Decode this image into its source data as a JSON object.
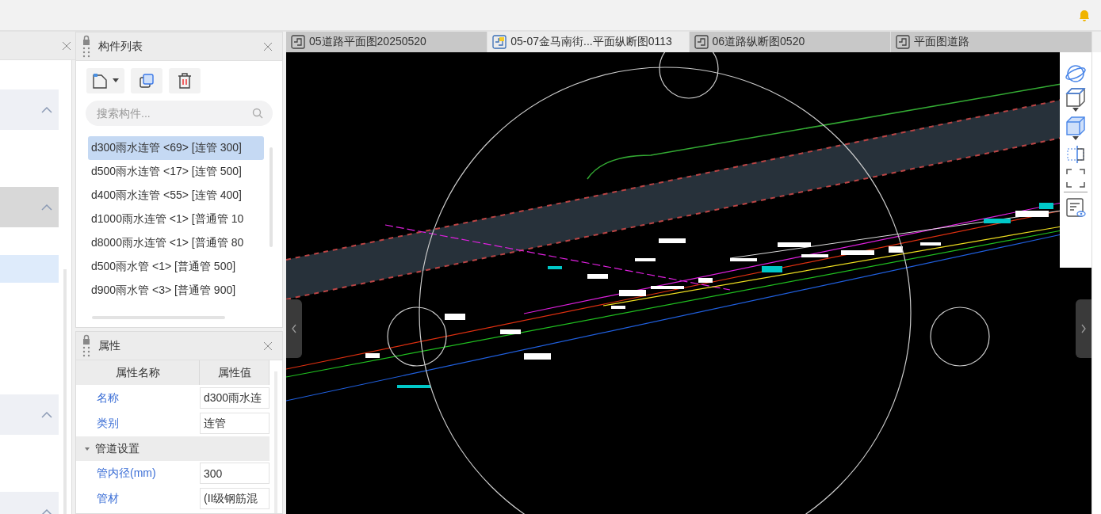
{
  "left_panel": {
    "sections": [
      {
        "kind": "group",
        "expanded": true,
        "active": false
      },
      {
        "kind": "group",
        "expanded": true,
        "active": true
      },
      {
        "kind": "row",
        "selected": true
      },
      {
        "kind": "group",
        "expanded": true,
        "active": false
      },
      {
        "kind": "group",
        "expanded": true,
        "active": false
      }
    ]
  },
  "component_list": {
    "title": "构件列表",
    "search": {
      "placeholder": "搜索构件..."
    },
    "items": [
      {
        "label": "d300雨水连管 <69> [连管 300]",
        "selected": true
      },
      {
        "label": "d500雨水连管 <17> [连管 500]",
        "selected": false
      },
      {
        "label": "d400雨水连管 <55> [连管 400]",
        "selected": false
      },
      {
        "label": "d1000雨水连管 <1> [普通管 10",
        "selected": false
      },
      {
        "label": "d8000雨水连管 <1> [普通管 80",
        "selected": false
      },
      {
        "label": "d500雨水管 <1> [普通管 500]",
        "selected": false
      },
      {
        "label": "d900雨水管 <3> [普通管 900]",
        "selected": false
      }
    ]
  },
  "properties": {
    "title": "属性",
    "columns": [
      "属性名称",
      "属性值"
    ],
    "rows": [
      {
        "kind": "field",
        "name": "名称",
        "value": "d300雨水连"
      },
      {
        "kind": "field",
        "name": "类别",
        "value": "连管"
      },
      {
        "kind": "group",
        "name": "管道设置",
        "expanded": true
      },
      {
        "kind": "field",
        "name": "管内径(mm)",
        "value": "300"
      },
      {
        "kind": "field",
        "name": "管材",
        "value": "(II级钢筋混"
      }
    ]
  },
  "tabs": [
    {
      "label": "05道路平面图20250520",
      "selected": false
    },
    {
      "label": "05-07金马南街...平面纵断图0113",
      "selected": true
    },
    {
      "label": "06道路纵断图0520",
      "selected": false
    },
    {
      "label": "平面图道路",
      "selected": false
    }
  ]
}
